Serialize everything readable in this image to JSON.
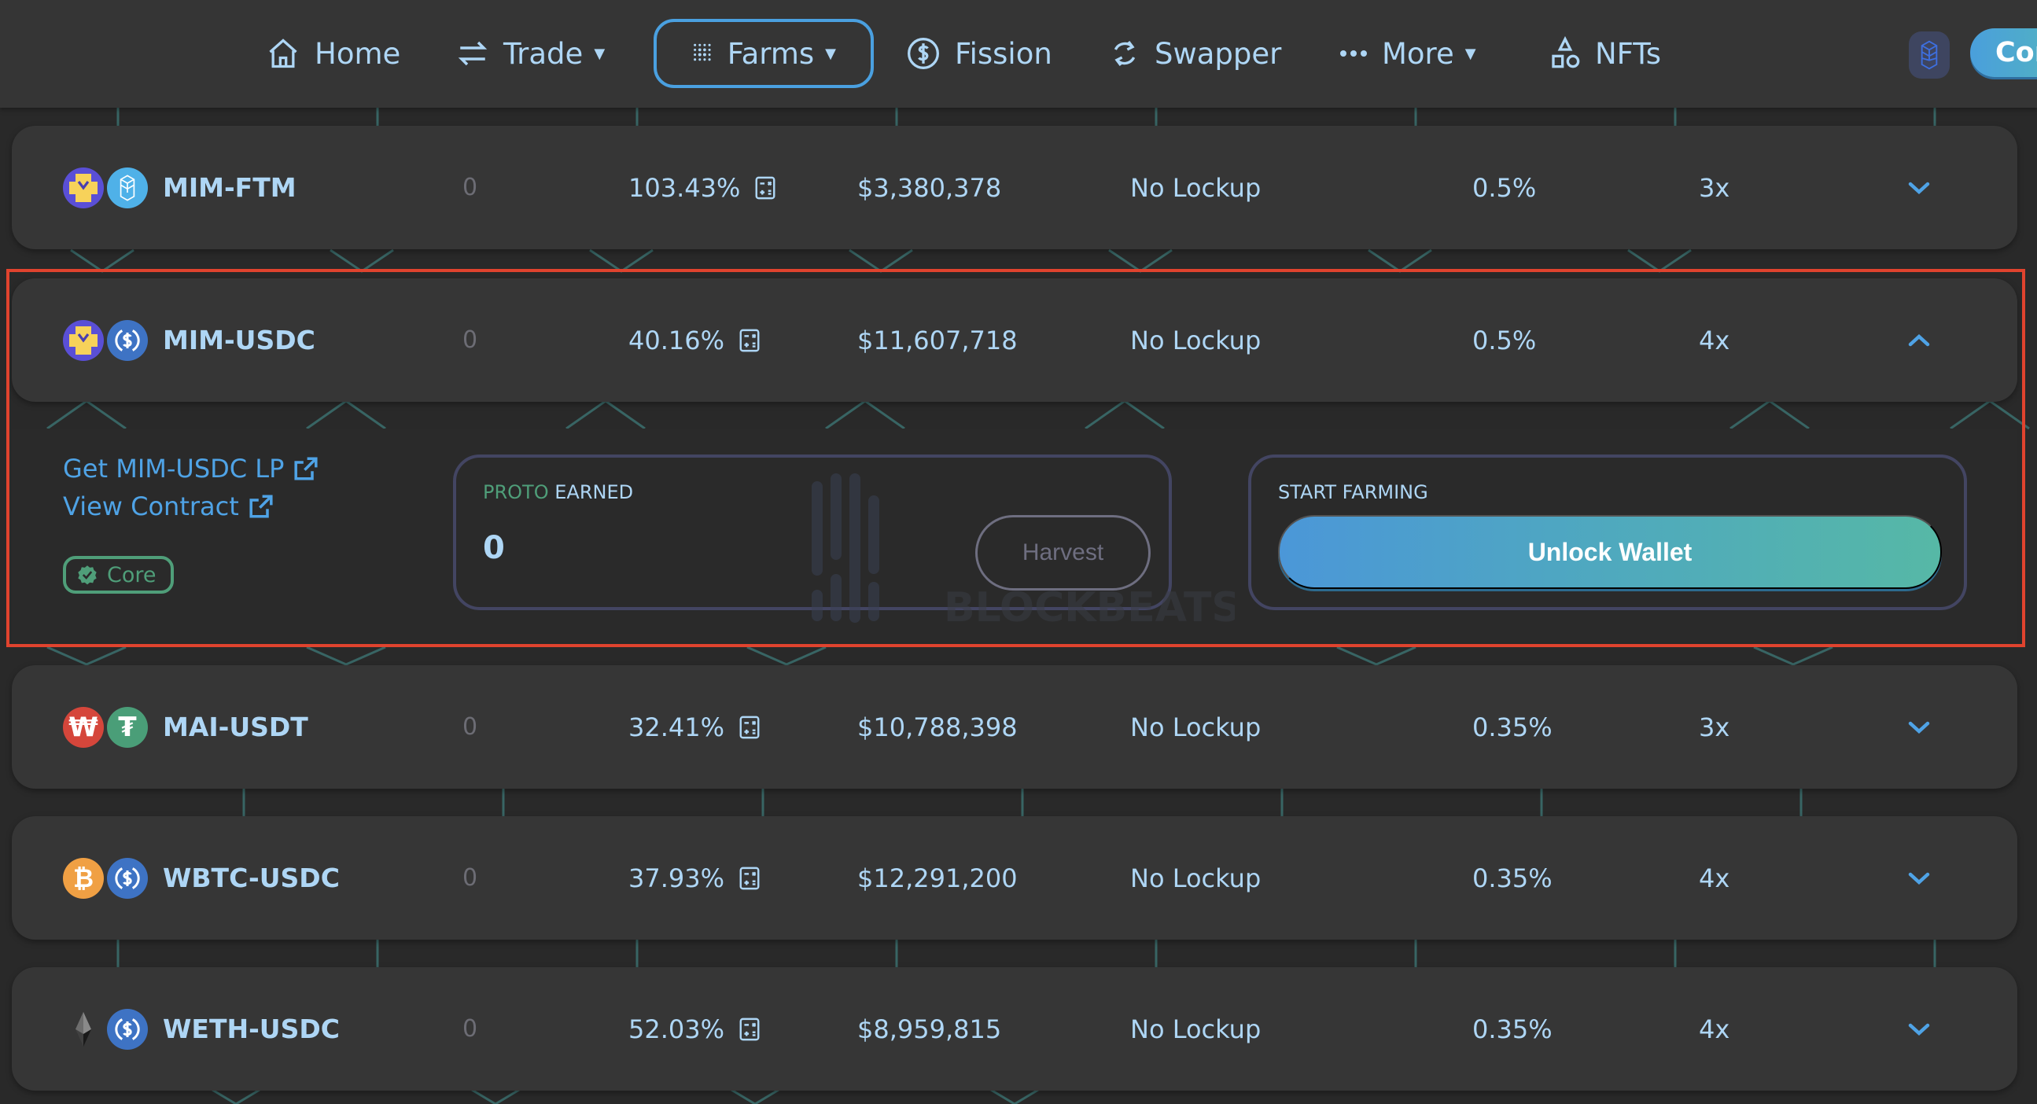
{
  "nav": {
    "items": [
      {
        "label": "Home",
        "icon": "home-icon",
        "has_dropdown": false,
        "active": false
      },
      {
        "label": "Trade",
        "icon": "swap-arrows-icon",
        "has_dropdown": true,
        "active": false
      },
      {
        "label": "Farms",
        "icon": "farm-dots-icon",
        "has_dropdown": true,
        "active": true
      },
      {
        "label": "Fission",
        "icon": "dollar-circle-icon",
        "has_dropdown": false,
        "active": false
      },
      {
        "label": "Swapper",
        "icon": "refresh-icon",
        "has_dropdown": false,
        "active": false
      },
      {
        "label": "More",
        "icon": "ellipsis-icon",
        "has_dropdown": true,
        "active": false
      },
      {
        "label": "NFTs",
        "icon": "shapes-icon",
        "has_dropdown": false,
        "active": false
      }
    ],
    "chain_icon": "fantom-icon",
    "connect_label": "Connect"
  },
  "farms": [
    {
      "pair": "MIM-FTM",
      "tokens": [
        "MIM",
        "FTM"
      ],
      "earned": "0",
      "apr": "103.43%",
      "liquidity": "$3,380,378",
      "lockup": "No Lockup",
      "fee": "0.5%",
      "multiplier": "3x",
      "expanded": false
    },
    {
      "pair": "MIM-USDC",
      "tokens": [
        "MIM",
        "USDC"
      ],
      "earned": "0",
      "apr": "40.16%",
      "liquidity": "$11,607,718",
      "lockup": "No Lockup",
      "fee": "0.5%",
      "multiplier": "4x",
      "expanded": true
    },
    {
      "pair": "MAI-USDT",
      "tokens": [
        "MAI",
        "USDT"
      ],
      "earned": "0",
      "apr": "32.41%",
      "liquidity": "$10,788,398",
      "lockup": "No Lockup",
      "fee": "0.35%",
      "multiplier": "3x",
      "expanded": false
    },
    {
      "pair": "WBTC-USDC",
      "tokens": [
        "WBTC",
        "USDC"
      ],
      "earned": "0",
      "apr": "37.93%",
      "liquidity": "$12,291,200",
      "lockup": "No Lockup",
      "fee": "0.35%",
      "multiplier": "4x",
      "expanded": false
    },
    {
      "pair": "WETH-USDC",
      "tokens": [
        "WETH",
        "USDC"
      ],
      "earned": "0",
      "apr": "52.03%",
      "liquidity": "$8,959,815",
      "lockup": "No Lockup",
      "fee": "0.35%",
      "multiplier": "4x",
      "expanded": false
    }
  ],
  "detail": {
    "get_lp_label": "Get MIM-USDC LP",
    "view_contract_label": "View Contract",
    "core_badge": "Core",
    "earned_token": "PROTO",
    "earned_label": "EARNED",
    "earned_value": "0",
    "harvest_label": "Harvest",
    "start_farming_label": "START FARMING",
    "unlock_label": "Unlock Wallet"
  },
  "watermark": {
    "text": "BLOCKBEATS"
  },
  "colors": {
    "accent_blue": "#4aa0e0",
    "text_blue": "#aed6f5",
    "core_green": "#4f9e79",
    "highlight_red": "#e0432e",
    "panel_border": "#434562"
  }
}
